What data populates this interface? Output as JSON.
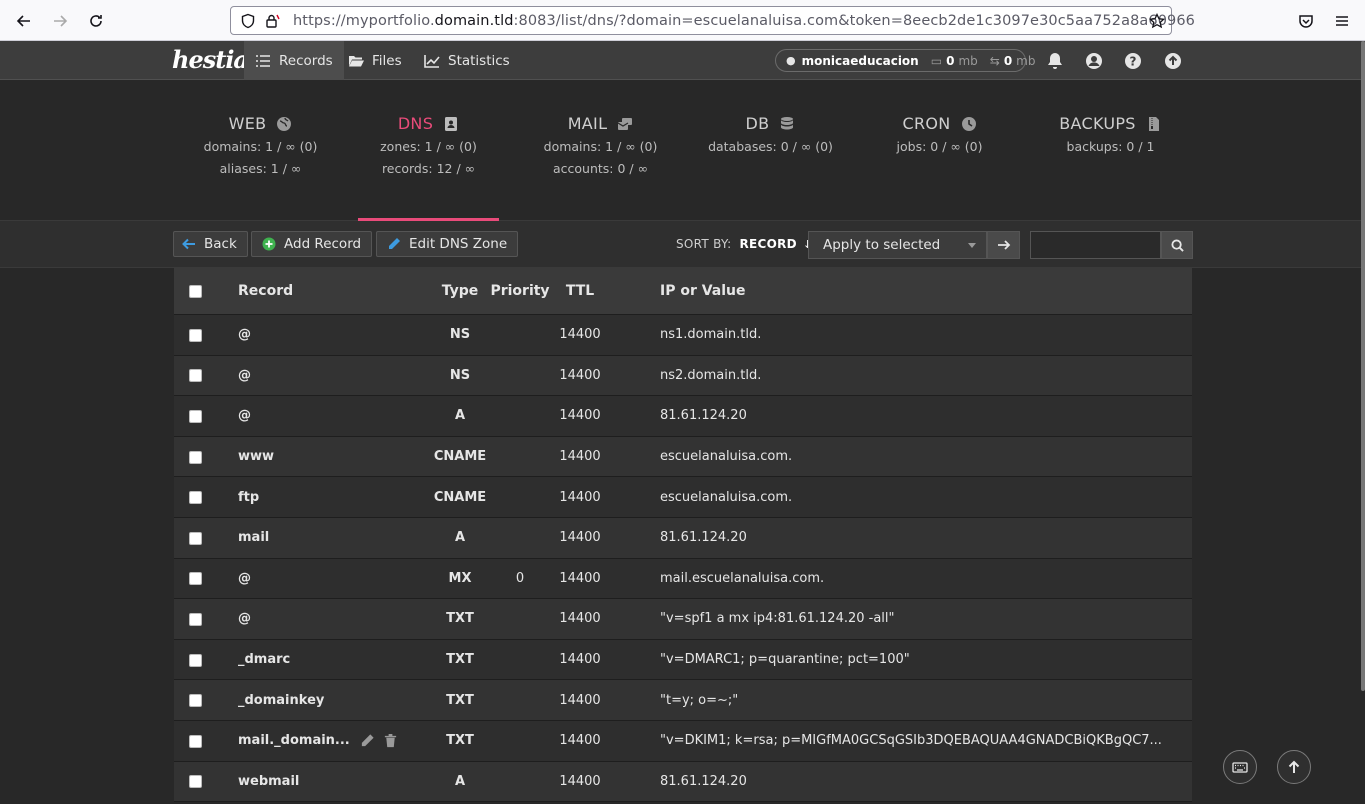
{
  "browser": {
    "url_prefix": "https://myportfolio.",
    "url_host": "domain.tld",
    "url_rest": ":8083/list/dns/?domain=escuelanaluisa.com&token=8eecb2de1c3097e30c5aa752a8a60966"
  },
  "topnav": {
    "logo": "hestia",
    "items": [
      {
        "label": "Records"
      },
      {
        "label": "Files"
      },
      {
        "label": "Statistics"
      }
    ],
    "user": {
      "name": "monicaeducacion",
      "disk": "0",
      "disk_unit": "mb",
      "bw": "0",
      "bw_unit": "mb"
    }
  },
  "stats": [
    {
      "title": "WEB",
      "line1": "domains: 1 / ∞ (0)",
      "line2": "aliases: 1 / ∞"
    },
    {
      "title": "DNS",
      "line1": "zones: 1 / ∞ (0)",
      "line2": "records: 12 / ∞"
    },
    {
      "title": "MAIL",
      "line1": "domains: 1 / ∞ (0)",
      "line2": "accounts: 0 / ∞"
    },
    {
      "title": "DB",
      "line1": "databases: 0 / ∞ (0)",
      "line2": ""
    },
    {
      "title": "CRON",
      "line1": "jobs: 0 / ∞ (0)",
      "line2": ""
    },
    {
      "title": "BACKUPS",
      "line1": "backups: 0 / 1",
      "line2": ""
    }
  ],
  "toolbar": {
    "back_label": "Back",
    "add_label": "Add Record",
    "edit_label": "Edit DNS Zone",
    "sort_label": "SORT BY:",
    "sort_value": "RECORD",
    "apply_label": "Apply to selected",
    "search_value": ""
  },
  "table": {
    "headers": {
      "record": "Record",
      "type": "Type",
      "priority": "Priority",
      "ttl": "TTL",
      "value": "IP or Value"
    },
    "rows": [
      {
        "record": "@",
        "type": "NS",
        "priority": "",
        "ttl": "14400",
        "value": "ns1.domain.tld."
      },
      {
        "record": "@",
        "type": "NS",
        "priority": "",
        "ttl": "14400",
        "value": "ns2.domain.tld."
      },
      {
        "record": "@",
        "type": "A",
        "priority": "",
        "ttl": "14400",
        "value": "81.61.124.20"
      },
      {
        "record": "www",
        "type": "CNAME",
        "priority": "",
        "ttl": "14400",
        "value": "escuelanaluisa.com."
      },
      {
        "record": "ftp",
        "type": "CNAME",
        "priority": "",
        "ttl": "14400",
        "value": "escuelanaluisa.com."
      },
      {
        "record": "mail",
        "type": "A",
        "priority": "",
        "ttl": "14400",
        "value": "81.61.124.20"
      },
      {
        "record": "@",
        "type": "MX",
        "priority": "0",
        "ttl": "14400",
        "value": "mail.escuelanaluisa.com."
      },
      {
        "record": "@",
        "type": "TXT",
        "priority": "",
        "ttl": "14400",
        "value": "\"v=spf1 a mx ip4:81.61.124.20 -all\""
      },
      {
        "record": "_dmarc",
        "type": "TXT",
        "priority": "",
        "ttl": "14400",
        "value": "\"v=DMARC1; p=quarantine; pct=100\""
      },
      {
        "record": "_domainkey",
        "type": "TXT",
        "priority": "",
        "ttl": "14400",
        "value": "\"t=y; o=~;\""
      },
      {
        "record": "mail._domain...",
        "type": "TXT",
        "priority": "",
        "ttl": "14400",
        "value": "\"v=DKIM1; k=rsa; p=MIGfMA0GCSqGSIb3DQEBAQUAA4GNADCBiQKBgQC7..."
      },
      {
        "record": "webmail",
        "type": "A",
        "priority": "",
        "ttl": "14400",
        "value": "81.61.124.20"
      }
    ]
  },
  "colors": {
    "accent": "#e94b7a",
    "background": "#282828",
    "nav": "#3d3d3d"
  }
}
